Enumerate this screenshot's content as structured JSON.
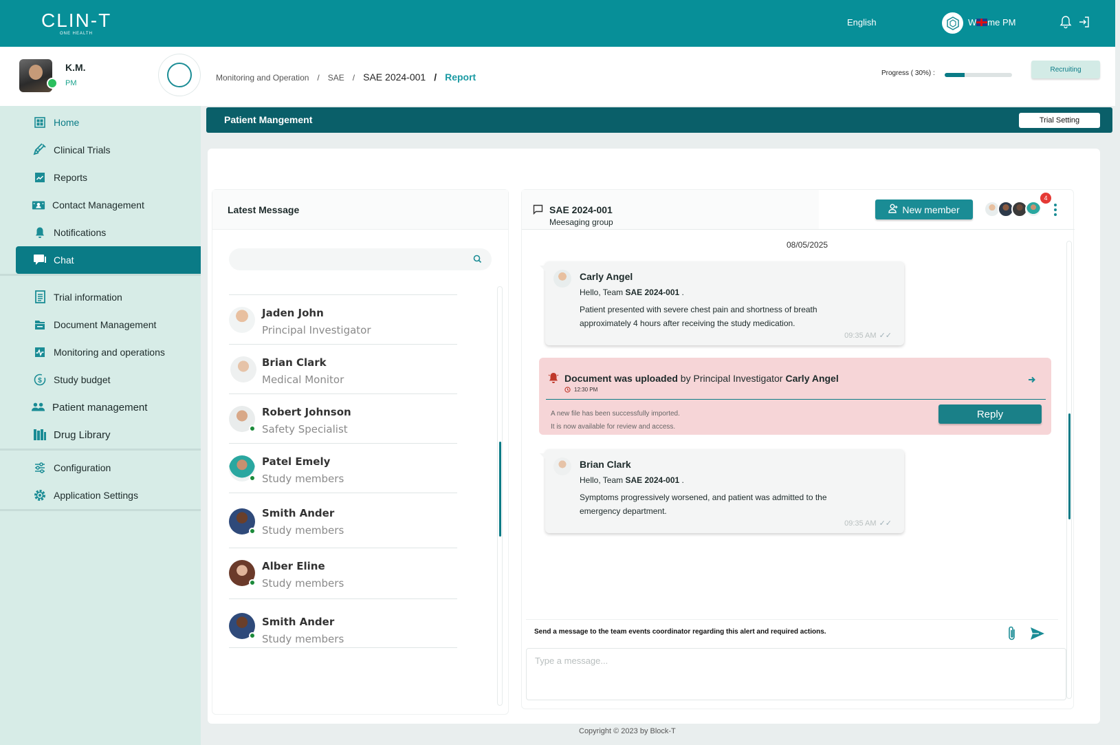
{
  "header": {
    "logo": "CLIN-T",
    "logo_sub": "ONE HEALTH",
    "language": "English",
    "hub_label": "W",
    "hub_label_tail": "me PM"
  },
  "user": {
    "name": "K.M.",
    "role": "PM"
  },
  "sidebar": {
    "items": [
      {
        "label": "Home",
        "icon": "grid-icon"
      },
      {
        "label": "Clinical Trials",
        "icon": "syringe-icon"
      },
      {
        "label": "Reports",
        "icon": "report-icon"
      },
      {
        "label": "Contact Management",
        "icon": "contact-icon"
      },
      {
        "label": "Notifications",
        "icon": "bell-icon"
      },
      {
        "label": "Chat",
        "icon": "chat-icon"
      },
      {
        "label": "Trial information",
        "icon": "document-icon"
      },
      {
        "label": "Document Management",
        "icon": "folder-icon"
      },
      {
        "label": "Monitoring and operations",
        "icon": "chart-icon"
      },
      {
        "label": "Study budget",
        "icon": "budget-icon"
      },
      {
        "label": "Patient management",
        "icon": "users-icon"
      },
      {
        "label": "Drug Library",
        "icon": "library-icon"
      },
      {
        "label": "Configuration",
        "icon": "sliders-icon"
      },
      {
        "label": "Application Settings",
        "icon": "gear-icon"
      }
    ]
  },
  "breadcrumb": {
    "items": [
      "Monitoring and Operation",
      "SAE",
      "SAE 2024-001",
      "Report"
    ],
    "separator": "/"
  },
  "progress": {
    "label": "Progress ( 30%) :",
    "value": 0.3
  },
  "status": {
    "label": "Recruiting"
  },
  "section": {
    "title": "Patient Mangement",
    "button": "Trial Setting"
  },
  "latest": {
    "title": "Latest Message",
    "search_placeholder": "",
    "contacts": [
      {
        "name": "Jaden John",
        "role": "Principal Investigator",
        "online": false
      },
      {
        "name": "Brian Clark",
        "role": "Medical Monitor",
        "online": false
      },
      {
        "name": "Robert Johnson",
        "role": "Safety Specialist",
        "online": true
      },
      {
        "name": "Patel Emely",
        "role": "Study members",
        "online": true
      },
      {
        "name": "Smith Ander",
        "role": "Study members",
        "online": true
      },
      {
        "name": "Alber Eline",
        "role": "Study members",
        "online": true
      },
      {
        "name": "Smith Ander",
        "role": "Study members",
        "online": true
      }
    ]
  },
  "chat": {
    "title": "SAE 2024-001",
    "subtitle": "Meesaging group",
    "new_member": "New member",
    "badge_count": "4",
    "date": "08/05/2025",
    "messages": [
      {
        "name": "Carly Angel",
        "greeting": "Hello, Team ",
        "greeting_bold": "SAE 2024-001",
        "greeting_tail": " .",
        "text": "Patient presented with severe chest pain and shortness of breath approximately 4 hours after receiving the study medication.",
        "time": "09:35 AM"
      },
      {
        "name": "Brian Clark",
        "greeting": "Hello, Team ",
        "greeting_bold": "SAE 2024-001",
        "greeting_tail": " .",
        "text": "Symptoms progressively worsened, and patient was admitted to the emergency department.",
        "time": "09:35 AM"
      }
    ],
    "alert": {
      "title_bold": "Document was uploaded",
      "title_rest": " by Principal Investigator",
      "name": "Carly Angel",
      "time": "12:30 PM",
      "line1": "A new file has been successfully imported.",
      "line2": "It is now available for review and access.",
      "reply": "Reply"
    },
    "hint": "Send a message to the team events coordinator regarding this alert and required actions.",
    "input_placeholder": "Type a message..."
  },
  "colors": {
    "primary": "#078f98",
    "dark": "#0a5f69",
    "accent": "#1a8c95",
    "alert_bg": "#f6d5d7",
    "sidebar_bg": "#d7ece7"
  },
  "footer": {
    "copyright": "Copyright © 2023 by Block-T"
  }
}
